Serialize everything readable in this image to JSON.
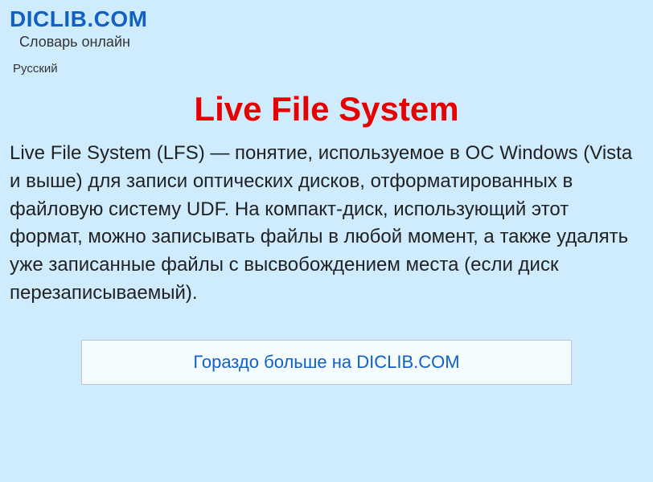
{
  "header": {
    "site_title": "DICLIB.COM",
    "subtitle": "Словарь онлайн",
    "language": "Русский"
  },
  "article": {
    "title": "Live File System",
    "body": "Live File System (LFS) — понятие, используемое в ОС Windows (Vista и выше) для записи оптических дисков, отформатированных в файловую систему UDF. На компакт-диск, использующий этот формат, можно записывать файлы в любой момент, а также удалять уже записанные файлы с высвобождением места (если диск перезаписываемый)."
  },
  "cta": {
    "label": "Гораздо больше на DICLIB.COM"
  },
  "colors": {
    "bg": "#cfecff",
    "accent_blue": "#1260c4",
    "title_red": "#e60000",
    "box_bg": "#f5fcfe",
    "box_border": "#b8c7d6"
  }
}
